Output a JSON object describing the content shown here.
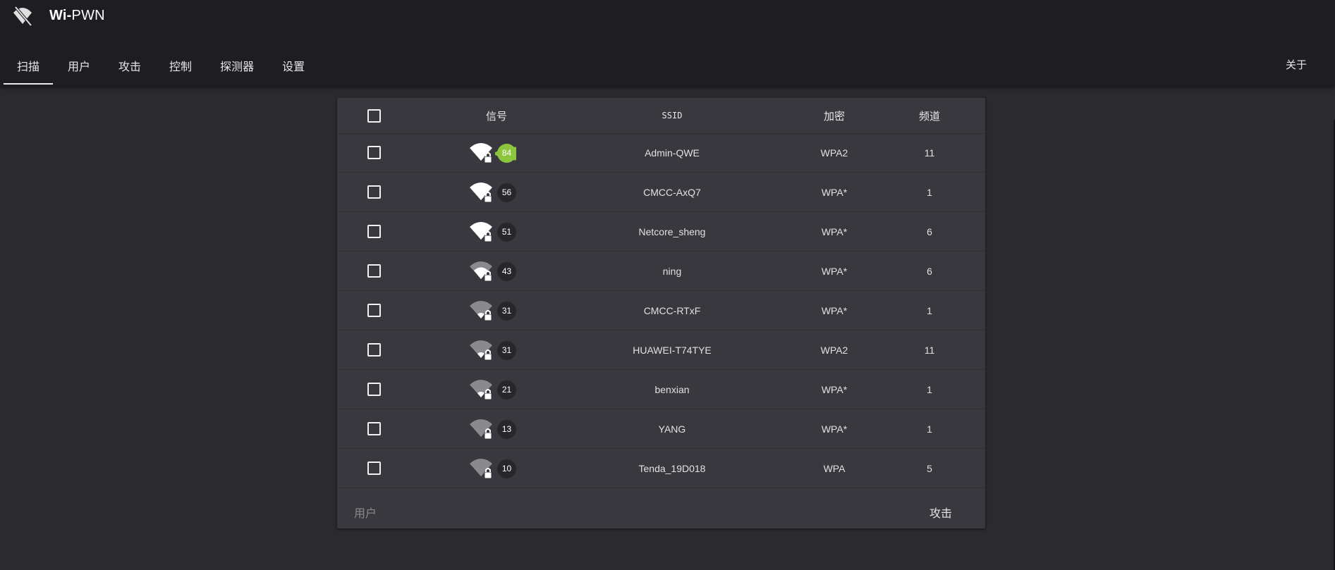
{
  "app": {
    "title_bold": "Wi-",
    "title_rest": "PWN",
    "logo_icon": "wifi-off-icon"
  },
  "nav": {
    "tabs": [
      {
        "label": "扫描",
        "active": true
      },
      {
        "label": "用户",
        "active": false
      },
      {
        "label": "攻击",
        "active": false
      },
      {
        "label": "控制",
        "active": false
      },
      {
        "label": "探测器",
        "active": false
      },
      {
        "label": "设置",
        "active": false
      }
    ],
    "about": "关于"
  },
  "table": {
    "headers": {
      "signal": "信号",
      "ssid": "SSID",
      "encryption": "加密",
      "channel": "频道"
    },
    "rows": [
      {
        "signal": 84,
        "ssid": "Admin-QWE",
        "encryption": "WPA2",
        "channel": "11",
        "badge_color": "#8cc63f"
      },
      {
        "signal": 56,
        "ssid": "CMCC-AxQ7",
        "encryption": "WPA*",
        "channel": "1",
        "badge_color": "#d9a520"
      },
      {
        "signal": 51,
        "ssid": "Netcore_sheng",
        "encryption": "WPA*",
        "channel": "6",
        "badge_color": "#d9a520"
      },
      {
        "signal": 43,
        "ssid": "ning",
        "encryption": "WPA*",
        "channel": "6",
        "badge_color": "#d98a24"
      },
      {
        "signal": 31,
        "ssid": "CMCC-RTxF",
        "encryption": "WPA*",
        "channel": "1",
        "badge_color": "#d9541e"
      },
      {
        "signal": 31,
        "ssid": "HUAWEI-T74TYE",
        "encryption": "WPA2",
        "channel": "11",
        "badge_color": "#d9541e"
      },
      {
        "signal": 21,
        "ssid": "benxian",
        "encryption": "WPA*",
        "channel": "1",
        "badge_color": "#d9301e"
      },
      {
        "signal": 13,
        "ssid": "YANG",
        "encryption": "WPA*",
        "channel": "1",
        "badge_color": "#c81e1e"
      },
      {
        "signal": 10,
        "ssid": "Tenda_19D018",
        "encryption": "WPA",
        "channel": "5",
        "badge_color": "#c81e1e"
      }
    ]
  },
  "footer": {
    "users_label": "用户",
    "attack_label": "攻击"
  }
}
